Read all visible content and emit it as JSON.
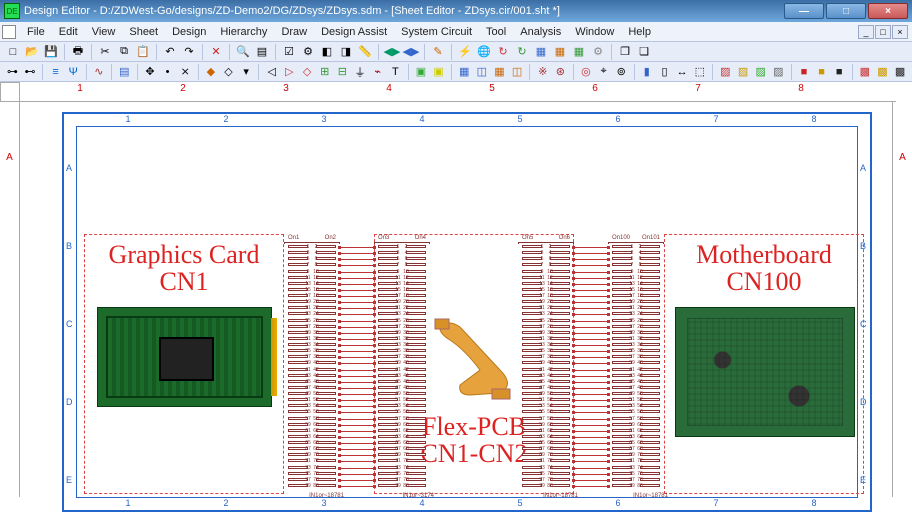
{
  "window": {
    "app_icon_text": "DE",
    "title": "Design Editor - D:/ZDWest-Go/designs/ZD-Demo2/DG/ZDsys/ZDsys.sdm - [Sheet Editor - ZDsys.cir/001.sht *]",
    "buttons": {
      "min": "—",
      "max": "□",
      "close": "×"
    }
  },
  "menus": [
    "File",
    "Edit",
    "View",
    "Sheet",
    "Design",
    "Hierarchy",
    "Draw",
    "Design Assist",
    "System Circuit",
    "Tool",
    "Analysis",
    "Window",
    "Help"
  ],
  "mdi": {
    "min": "_",
    "max": "□",
    "close": "×"
  },
  "toolbar1": [
    {
      "n": "new-icon",
      "g": "□"
    },
    {
      "n": "open-icon",
      "g": "📂"
    },
    {
      "n": "save-icon",
      "g": "💾"
    },
    {
      "sep": true
    },
    {
      "n": "print-icon",
      "g": "🖶"
    },
    {
      "sep": true
    },
    {
      "n": "cut-icon",
      "g": "✂"
    },
    {
      "n": "copy-icon",
      "g": "⧉"
    },
    {
      "n": "paste-icon",
      "g": "📋"
    },
    {
      "sep": true
    },
    {
      "n": "undo-icon",
      "g": "↶"
    },
    {
      "n": "redo-icon",
      "g": "↷"
    },
    {
      "sep": true
    },
    {
      "n": "delete-icon",
      "g": "✕",
      "c": "#c22"
    },
    {
      "sep": true
    },
    {
      "n": "search-icon",
      "g": "🔍"
    },
    {
      "n": "filter-icon",
      "g": "▤"
    },
    {
      "sep": true
    },
    {
      "n": "check-icon",
      "g": "☑"
    },
    {
      "n": "options-icon",
      "g": "⚙"
    },
    {
      "n": "tool-a-icon",
      "g": "◧"
    },
    {
      "n": "tool-b-icon",
      "g": "◨"
    },
    {
      "n": "ruler-icon",
      "g": "📏",
      "c": "#cc0"
    },
    {
      "sep": true
    },
    {
      "n": "nav-a-icon",
      "g": "◀▶",
      "c": "#096"
    },
    {
      "n": "nav-b-icon",
      "g": "◀▶",
      "c": "#36c"
    },
    {
      "sep": true
    },
    {
      "n": "annot-icon",
      "g": "✎",
      "c": "#c60"
    },
    {
      "sep": true
    },
    {
      "n": "bolt-icon",
      "g": "⚡",
      "c": "#cc0"
    },
    {
      "n": "world-icon",
      "g": "🌐"
    },
    {
      "n": "sync-a-icon",
      "g": "↻",
      "c": "#c33"
    },
    {
      "n": "sync-b-icon",
      "g": "↻",
      "c": "#393"
    },
    {
      "n": "sheet-a-icon",
      "g": "▦",
      "c": "#36c"
    },
    {
      "n": "sheet-b-icon",
      "g": "▦",
      "c": "#c60"
    },
    {
      "n": "sheet-c-icon",
      "g": "▦",
      "c": "#393"
    },
    {
      "n": "gear-icon",
      "g": "⚙",
      "c": "#888"
    },
    {
      "sep": true
    },
    {
      "n": "win-a-icon",
      "g": "❐"
    },
    {
      "n": "win-b-icon",
      "g": "❏"
    }
  ],
  "toolbar2": [
    {
      "n": "conn-a-icon",
      "g": "⊶"
    },
    {
      "n": "conn-b-icon",
      "g": "⊷"
    },
    {
      "sep": true
    },
    {
      "n": "bus-a-icon",
      "g": "≡",
      "c": "#06c"
    },
    {
      "n": "bus-b-icon",
      "g": "Ψ",
      "c": "#06c"
    },
    {
      "sep": true
    },
    {
      "n": "wire-icon",
      "g": "∿",
      "c": "#a33"
    },
    {
      "sep": true
    },
    {
      "n": "align-icon",
      "g": "▤",
      "c": "#36c"
    },
    {
      "sep": true
    },
    {
      "n": "move-icon",
      "g": "✥"
    },
    {
      "n": "junction-icon",
      "g": "•"
    },
    {
      "n": "noconn-icon",
      "g": "⨯"
    },
    {
      "sep": true
    },
    {
      "n": "erc-a-icon",
      "g": "◆",
      "c": "#c60"
    },
    {
      "n": "erc-b-icon",
      "g": "◇"
    },
    {
      "n": "arrow-dn-icon",
      "g": "▾"
    },
    {
      "sep": true
    },
    {
      "n": "port-a-icon",
      "g": "◁"
    },
    {
      "n": "port-b-icon",
      "g": "▷",
      "c": "#c33"
    },
    {
      "n": "port-c-icon",
      "g": "◇",
      "c": "#c33"
    },
    {
      "n": "net-a-icon",
      "g": "⊞",
      "c": "#393"
    },
    {
      "n": "net-b-icon",
      "g": "⊟",
      "c": "#393"
    },
    {
      "n": "ground-icon",
      "g": "⏚"
    },
    {
      "n": "power-icon",
      "g": "⌁",
      "c": "#a00"
    },
    {
      "n": "text-icon",
      "g": "T"
    },
    {
      "sep": true
    },
    {
      "n": "layer-a-icon",
      "g": "▣",
      "c": "#3a3"
    },
    {
      "n": "layer-b-icon",
      "g": "▣",
      "c": "#cc0"
    },
    {
      "sep": true
    },
    {
      "n": "hier-a-icon",
      "g": "▦",
      "c": "#36c"
    },
    {
      "n": "hier-b-icon",
      "g": "◫",
      "c": "#36c"
    },
    {
      "n": "hier-c-icon",
      "g": "▦",
      "c": "#c60"
    },
    {
      "n": "hier-d-icon",
      "g": "◫",
      "c": "#c60"
    },
    {
      "sep": true
    },
    {
      "n": "sim-a-icon",
      "g": "※",
      "c": "#a33"
    },
    {
      "n": "sim-b-icon",
      "g": "⊛",
      "c": "#a33"
    },
    {
      "sep": true
    },
    {
      "n": "drc-a-icon",
      "g": "◎",
      "c": "#c33"
    },
    {
      "n": "drc-b-icon",
      "g": "⌖"
    },
    {
      "n": "drc-c-icon",
      "g": "⊚"
    },
    {
      "sep": true
    },
    {
      "n": "part-a-icon",
      "g": "▮",
      "c": "#36c"
    },
    {
      "n": "part-b-icon",
      "g": "▯"
    },
    {
      "n": "dim-icon",
      "g": "↔"
    },
    {
      "n": "select-icon",
      "g": "⬚"
    },
    {
      "sep": true
    },
    {
      "n": "hatch-a-icon",
      "g": "▨",
      "c": "#c33"
    },
    {
      "n": "hatch-b-icon",
      "g": "▨",
      "c": "#c90"
    },
    {
      "n": "hatch-c-icon",
      "g": "▨",
      "c": "#3a3"
    },
    {
      "n": "hatch-d-icon",
      "g": "▨",
      "c": "#666"
    },
    {
      "sep": true
    },
    {
      "n": "stop-a-icon",
      "g": "■",
      "c": "#c22"
    },
    {
      "n": "stop-b-icon",
      "g": "■",
      "c": "#c90"
    },
    {
      "n": "stop-c-icon",
      "g": "■",
      "c": "#222"
    },
    {
      "sep": true
    },
    {
      "n": "hatch-e-icon",
      "g": "▩",
      "c": "#c33"
    },
    {
      "n": "hatch-f-icon",
      "g": "▩",
      "c": "#c90"
    },
    {
      "n": "hatch-g-icon",
      "g": "▩",
      "c": "#222"
    }
  ],
  "outer_ruler": {
    "h": [
      "1",
      "2",
      "3",
      "4",
      "5",
      "6",
      "7",
      "8"
    ],
    "v": [
      "A"
    ]
  },
  "sheet_ruler": {
    "h": [
      "1",
      "2",
      "3",
      "4",
      "5",
      "6",
      "7",
      "8"
    ],
    "v": [
      "A",
      "B",
      "C",
      "D",
      "E"
    ]
  },
  "blocks": {
    "graphics": {
      "title_l1": "Graphics Card",
      "title_l2": "CN1"
    },
    "flex": {
      "title_l1": "Flex-PCB",
      "title_l2": "CN1-CN2"
    },
    "mobo": {
      "title_l1": "Motherboard",
      "title_l2": "CN100"
    }
  },
  "connectors": {
    "c1": {
      "name_l": "On1",
      "name_r": "On2",
      "ref": "IN1or~18781",
      "pins": 40
    },
    "c2": {
      "name_l": "On3",
      "name_r": "On4",
      "ref": "IN1or~3174",
      "pins": 40
    },
    "c3": {
      "name_l": "On5",
      "name_r": "On6",
      "ref": "IN1or~18781",
      "pins": 40
    },
    "c4": {
      "name_l": "On100",
      "name_r": "On101",
      "ref": "IN1or~18781",
      "pins": 40
    }
  }
}
